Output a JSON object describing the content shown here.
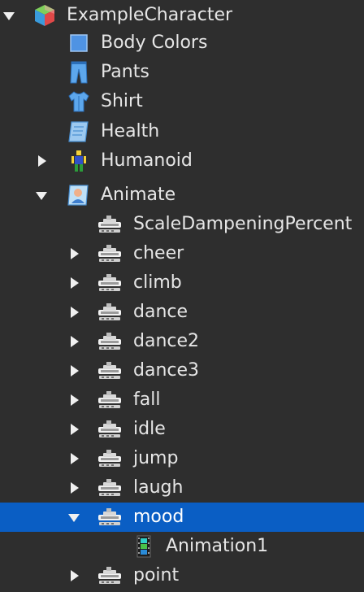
{
  "explorer": {
    "root": {
      "label": "ExampleCharacter",
      "icon": "model-icon"
    },
    "items": [
      {
        "label": "Body Colors",
        "icon": "body-colors-icon"
      },
      {
        "label": "Pants",
        "icon": "pants-icon"
      },
      {
        "label": "Shirt",
        "icon": "shirt-icon"
      },
      {
        "label": "Health",
        "icon": "script-icon"
      },
      {
        "label": "Humanoid",
        "icon": "humanoid-icon"
      },
      {
        "label": "Animate",
        "icon": "local-script-icon"
      }
    ],
    "animate_children": [
      {
        "label": "ScaleDampeningPercent",
        "icon": "value-icon"
      },
      {
        "label": "cheer",
        "icon": "value-icon"
      },
      {
        "label": "climb",
        "icon": "value-icon"
      },
      {
        "label": "dance",
        "icon": "value-icon"
      },
      {
        "label": "dance2",
        "icon": "value-icon"
      },
      {
        "label": "dance3",
        "icon": "value-icon"
      },
      {
        "label": "fall",
        "icon": "value-icon"
      },
      {
        "label": "idle",
        "icon": "value-icon"
      },
      {
        "label": "jump",
        "icon": "value-icon"
      },
      {
        "label": "laugh",
        "icon": "value-icon"
      },
      {
        "label": "mood",
        "icon": "value-icon",
        "selected": true
      },
      {
        "label": "point",
        "icon": "value-icon"
      }
    ],
    "mood_children": [
      {
        "label": "Animation1",
        "icon": "animation-icon"
      }
    ],
    "colors": {
      "background": "#2e2e2e",
      "selection": "#0a5ec4",
      "text": "#e6e6e6"
    }
  }
}
